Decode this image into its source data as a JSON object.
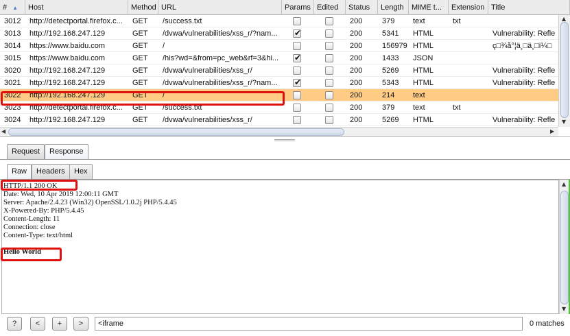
{
  "table": {
    "columns": [
      {
        "key": "num",
        "label": "#",
        "w": 37
      },
      {
        "key": "host",
        "label": "Host",
        "w": 150
      },
      {
        "key": "method",
        "label": "Method",
        "w": 44
      },
      {
        "key": "url",
        "label": "URL",
        "w": 180
      },
      {
        "key": "params",
        "label": "Params",
        "w": 47
      },
      {
        "key": "edited",
        "label": "Edited",
        "w": 46
      },
      {
        "key": "status",
        "label": "Status",
        "w": 47
      },
      {
        "key": "length",
        "label": "Length",
        "w": 45
      },
      {
        "key": "mime",
        "label": "MIME t...",
        "w": 58
      },
      {
        "key": "extension",
        "label": "Extension",
        "w": 58
      },
      {
        "key": "title",
        "label": "Title",
        "w": 119
      }
    ],
    "rows": [
      {
        "num": "3012",
        "host": "http://detectportal.firefox.c...",
        "method": "GET",
        "url": "/success.txt",
        "params": false,
        "edited": false,
        "status": "200",
        "length": "379",
        "mime": "text",
        "extension": "txt",
        "title": "",
        "selected": false
      },
      {
        "num": "3013",
        "host": "http://192.168.247.129",
        "method": "GET",
        "url": "/dvwa/vulnerabilities/xss_r/?nam...",
        "params": true,
        "edited": false,
        "status": "200",
        "length": "5341",
        "mime": "HTML",
        "extension": "",
        "title": "Vulnerability: Refle",
        "selected": false
      },
      {
        "num": "3014",
        "host": "https://www.baidu.com",
        "method": "GET",
        "url": "/",
        "params": false,
        "edited": false,
        "status": "200",
        "length": "156979",
        "mime": "HTML",
        "extension": "",
        "title": "ç□¾å°¦ä¸□ä¸□ï¼□",
        "selected": false
      },
      {
        "num": "3015",
        "host": "https://www.baidu.com",
        "method": "GET",
        "url": "/his?wd=&from=pc_web&rf=3&hi...",
        "params": true,
        "edited": false,
        "status": "200",
        "length": "1433",
        "mime": "JSON",
        "extension": "",
        "title": "",
        "selected": false
      },
      {
        "num": "3020",
        "host": "http://192.168.247.129",
        "method": "GET",
        "url": "/dvwa/vulnerabilities/xss_r/",
        "params": false,
        "edited": false,
        "status": "200",
        "length": "5269",
        "mime": "HTML",
        "extension": "",
        "title": "Vulnerability: Refle",
        "selected": false
      },
      {
        "num": "3021",
        "host": "http://192.168.247.129",
        "method": "GET",
        "url": "/dvwa/vulnerabilities/xss_r/?nam...",
        "params": true,
        "edited": false,
        "status": "200",
        "length": "5343",
        "mime": "HTML",
        "extension": "",
        "title": "Vulnerability: Refle",
        "selected": false
      },
      {
        "num": "3022",
        "host": "http://192.168.247.129",
        "method": "GET",
        "url": "/",
        "params": false,
        "edited": false,
        "status": "200",
        "length": "214",
        "mime": "text",
        "extension": "",
        "title": "",
        "selected": true
      },
      {
        "num": "3023",
        "host": "http://detectportal.firefox.c...",
        "method": "GET",
        "url": "/success.txt",
        "params": false,
        "edited": false,
        "status": "200",
        "length": "379",
        "mime": "text",
        "extension": "txt",
        "title": "",
        "selected": false
      },
      {
        "num": "3024",
        "host": "http://192.168.247.129",
        "method": "GET",
        "url": "/dvwa/vulnerabilities/xss_r/",
        "params": false,
        "edited": false,
        "status": "200",
        "length": "5269",
        "mime": "HTML",
        "extension": "",
        "title": "Vulnerability: Refle",
        "selected": false
      }
    ]
  },
  "tabs": {
    "request": "Request",
    "response": "Response",
    "active": "response"
  },
  "subtabs": {
    "raw": "Raw",
    "headers": "Headers",
    "hex": "Hex",
    "active": "raw"
  },
  "response_lines": [
    "HTTP/1.1 200 OK",
    "Date: Wed, 10 Apr 2019 12:00:11 GMT",
    "Server: Apache/2.4.23 (Win32) OpenSSL/1.0.2j PHP/5.4.45",
    "X-Powered-By: PHP/5.4.45",
    "Content-Length: 11",
    "Connection: close",
    "Content-Type: text/html",
    "",
    "Hello World"
  ],
  "search": {
    "help_label": "?",
    "prev_label": "<",
    "add_label": "+",
    "next_label": ">",
    "value": "<iframe",
    "matches": "0 matches"
  },
  "colors": {
    "selected_row": "#ffcb85",
    "annotation": "#e01010"
  }
}
